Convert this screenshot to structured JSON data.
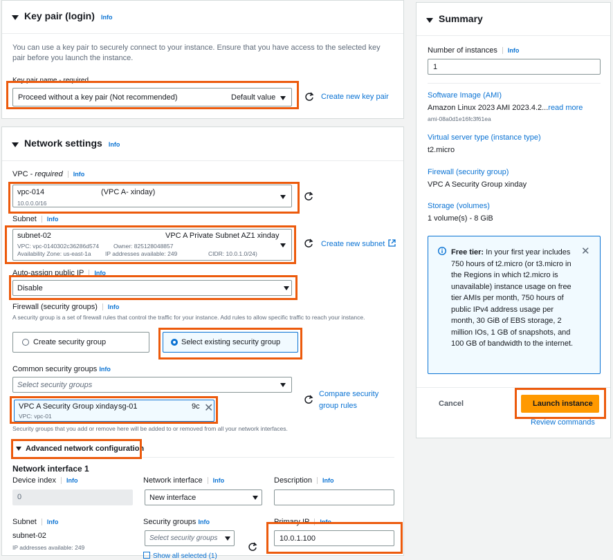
{
  "keypair": {
    "title": "Key pair (login)",
    "info": "Info",
    "desc": "You can use a key pair to securely connect to your instance. Ensure that you have access to the selected key pair before you launch the instance.",
    "name_label": "Key pair name - required",
    "value": "Proceed without a key pair (Not recommended)",
    "default": "Default value",
    "create_link": "Create new key pair"
  },
  "network": {
    "title": "Network settings",
    "info": "Info",
    "vpc_label": "VPC - ",
    "vpc_required": "required",
    "vpc_value": "vpc-014",
    "vpc_suffix": "(VPC A- xinday)",
    "vpc_sub": "10.0.0.0/16",
    "subnet_label": "Subnet",
    "subnet_value": "subnet-02",
    "subnet_name": "VPC A Private Subnet AZ1 xinday",
    "subnet_vpc": "VPC: vpc-0140302c36286d574",
    "subnet_owner": "Owner: 825128048857",
    "subnet_az": "Availability Zone: us-east-1a",
    "subnet_ips": "IP addresses available: 249",
    "subnet_cidr": "CIDR: 10.0.1.0/24)",
    "create_subnet": "Create new subnet",
    "public_ip_label": "Auto-assign public IP",
    "public_ip_value": "Disable",
    "firewall_label": "Firewall (security groups)",
    "firewall_desc": "A security group is a set of firewall rules that control the traffic for your instance. Add rules to allow specific traffic to reach your instance.",
    "create_sg": "Create security group",
    "select_sg": "Select existing security group",
    "common_sg_label": "Common security groups",
    "sg_placeholder": "Select security groups",
    "sg_token_name": "VPC A Security Group xinday",
    "sg_token_id": "sg-01",
    "sg_token_tail": "9c",
    "sg_token_vpc": "VPC: vpc-01",
    "compare_link": "Compare security group rules",
    "sg_note": "Security groups that you add or remove here will be added to or removed from all your network interfaces.",
    "advanced": "Advanced network configuration",
    "ni_title": "Network interface 1",
    "device_index_label": "Device index",
    "device_index_value": "0",
    "ni_label": "Network interface",
    "ni_value": "New interface",
    "desc_label": "Description",
    "subnet2_label": "Subnet",
    "subnet2_value": "subnet-02",
    "subnet2_ips": "IP addresses available: 249",
    "sg2_label": "Security groups",
    "sg2_placeholder": "Select security groups",
    "show_all": "Show all selected (1)",
    "primary_ip_label": "Primary IP",
    "primary_ip_value": "10.0.1.100"
  },
  "summary": {
    "title": "Summary",
    "num_label": "Number of instances",
    "info": "Info",
    "num_value": "1",
    "ami_label": "Software Image (AMI)",
    "ami_value": "Amazon Linux 2023 AMI 2023.4.2...",
    "ami_more": "read more",
    "ami_id": "ami-08a0d1e16fc3f61ea",
    "type_label": "Virtual server type (instance type)",
    "type_value": "t2.micro",
    "fw_label": "Firewall (security group)",
    "fw_value": "VPC A Security Group xinday",
    "storage_label": "Storage (volumes)",
    "storage_value": "1 volume(s) - 8 GiB",
    "free_title": "Free tier:",
    "free_text": "In your first year includes 750 hours of t2.micro (or t3.micro in the Regions in which t2.micro is unavailable) instance usage on free tier AMIs per month, 750 hours of public IPv4 address usage per month, 30 GiB of EBS storage, 2 million IOs, 1 GB of snapshots, and 100 GB of bandwidth to the internet.",
    "cancel": "Cancel",
    "launch": "Launch instance",
    "review": "Review commands"
  },
  "colors": {
    "accent": "#0972d3",
    "highlight": "#ec5a0c",
    "launch": "#ff9900"
  }
}
